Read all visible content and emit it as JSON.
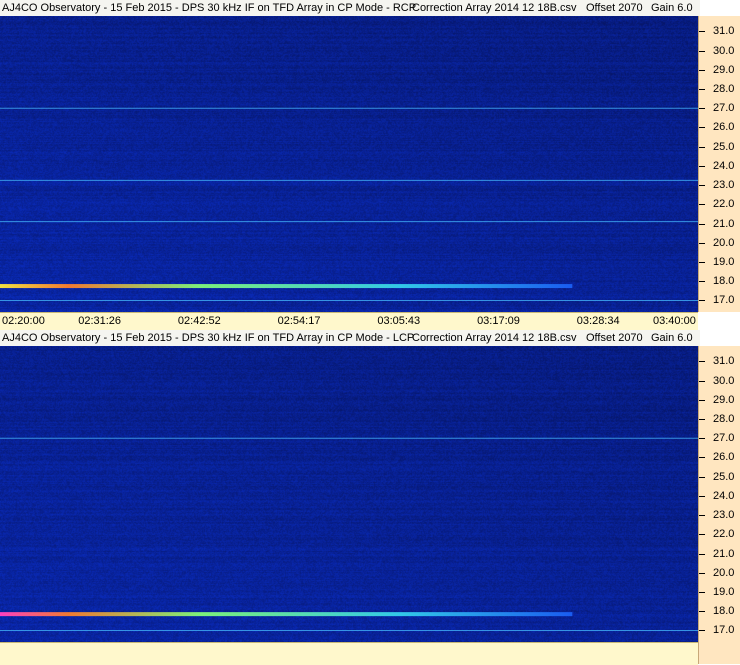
{
  "chart_data": [
    {
      "type": "heatmap",
      "title": "AJ4CO Observatory - 15 Feb 2015 - DPS 30 kHz IF on TFD Array in CP Mode - RCP",
      "correction": "Correction Array 2014 12 18B.csv",
      "offset": "Offset 2070",
      "gain": "Gain 6.0",
      "x_ticks": [
        "02:20:00",
        "02:31:26",
        "02:42:52",
        "02:54:17",
        "03:05:43",
        "03:17:09",
        "03:28:34",
        "03:40:00"
      ],
      "y_ticks": [
        "31.0",
        "30.0",
        "29.0",
        "28.0",
        "27.0",
        "26.0",
        "25.0",
        "24.0",
        "23.0",
        "22.0",
        "21.0",
        "20.0",
        "19.0",
        "18.0",
        "17.0"
      ],
      "ylim": [
        16.4,
        31.8
      ],
      "colormap": [
        "#05125a",
        "#0a2ab8",
        "#1a5cf0",
        "#32c8e8",
        "#7cf07a",
        "#f0e040",
        "#f07a30",
        "#ff40c0"
      ],
      "features": [
        {
          "kind": "burst_band",
          "y": 17.75,
          "x_end_fraction": 0.82,
          "peak": "yellow"
        },
        {
          "kind": "line",
          "y": 27.0
        },
        {
          "kind": "line",
          "y": 23.25
        },
        {
          "kind": "line",
          "y": 21.1
        },
        {
          "kind": "line",
          "y": 17.0
        }
      ]
    },
    {
      "type": "heatmap",
      "title": "AJ4CO Observatory - 15 Feb 2015 - DPS 30 kHz IF on TFD Array in CP Mode - LCP",
      "correction": "Correction Array 2014 12 18B.csv",
      "offset": "Offset 2070",
      "gain": "Gain 6.0",
      "x_ticks": [],
      "y_ticks": [
        "31.0",
        "30.0",
        "29.0",
        "28.0",
        "27.0",
        "26.0",
        "25.0",
        "24.0",
        "23.0",
        "22.0",
        "21.0",
        "20.0",
        "19.0",
        "18.0",
        "17.0"
      ],
      "ylim": [
        16.4,
        31.8
      ],
      "colormap": [
        "#05125a",
        "#0a2ab8",
        "#1a5cf0",
        "#32c8e8",
        "#7cf07a",
        "#f0e040",
        "#f07a30",
        "#ff40c0"
      ],
      "features": [
        {
          "kind": "burst_band",
          "y": 17.85,
          "x_end_fraction": 0.82,
          "peak": "magenta"
        },
        {
          "kind": "line",
          "y": 27.0
        },
        {
          "kind": "line",
          "y": 17.0
        }
      ]
    }
  ]
}
